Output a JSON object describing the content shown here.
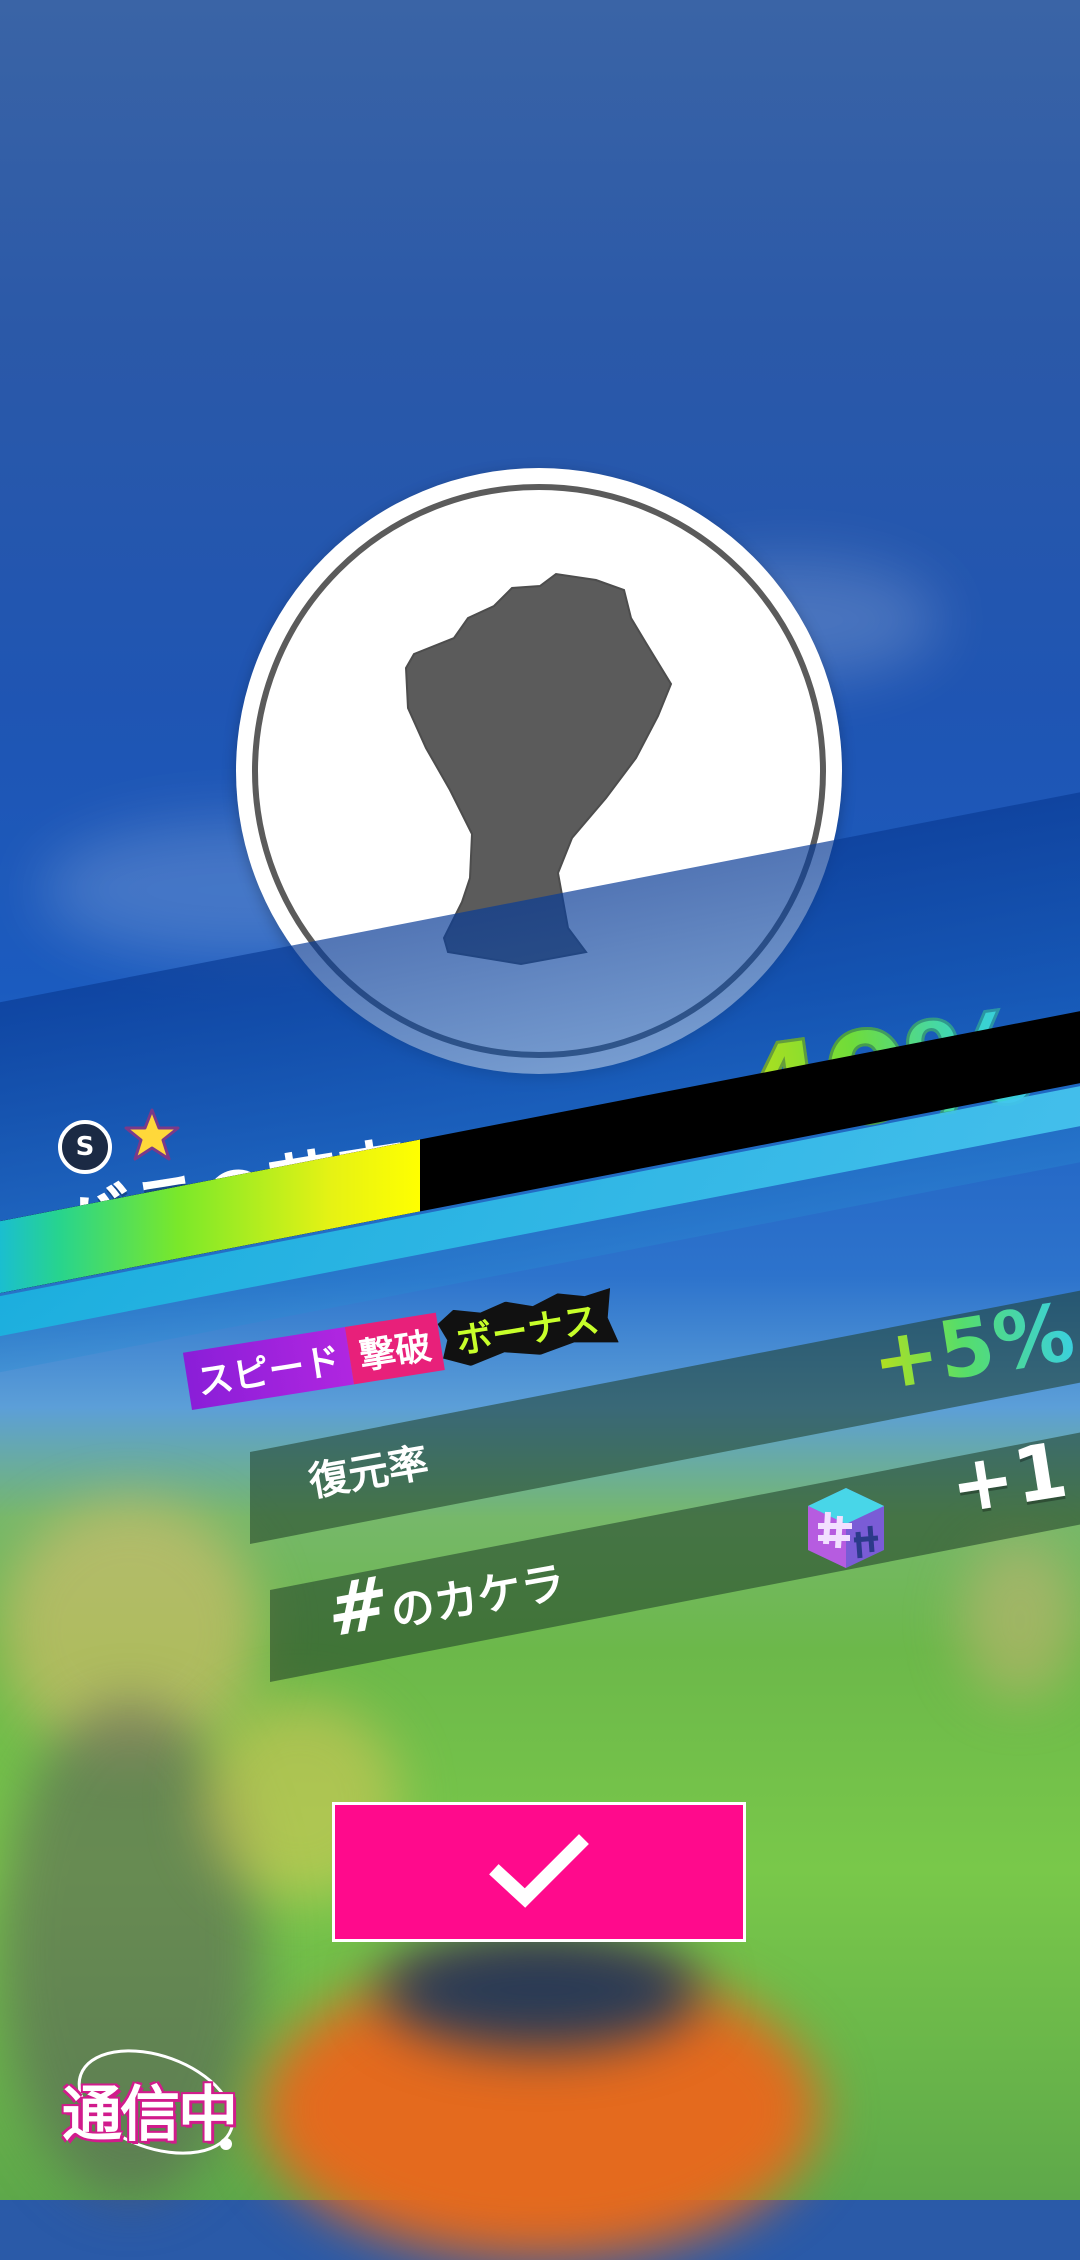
{
  "result": {
    "percent_text": "40%",
    "progress": 0.4,
    "rank_badge": "S",
    "item_name": "バラの花束"
  },
  "bonus": {
    "speed": "スピード",
    "defeat": "撃破",
    "bonus": "ボーナス"
  },
  "rewards": [
    {
      "label": "復元率",
      "value": "+5%"
    },
    {
      "label": "のカケラ",
      "icon": "#",
      "value": "+1"
    }
  ],
  "status": {
    "text": "通信中"
  },
  "colors": {
    "accent_pink": "#ff0a8c",
    "silhouette_gray": "#5b5b5b"
  },
  "icons": {
    "rank": "s-rank-badge-icon",
    "star": "star-icon",
    "confirm": "checkmark-icon",
    "fragment": "hash-fragment-cube-icon"
  }
}
